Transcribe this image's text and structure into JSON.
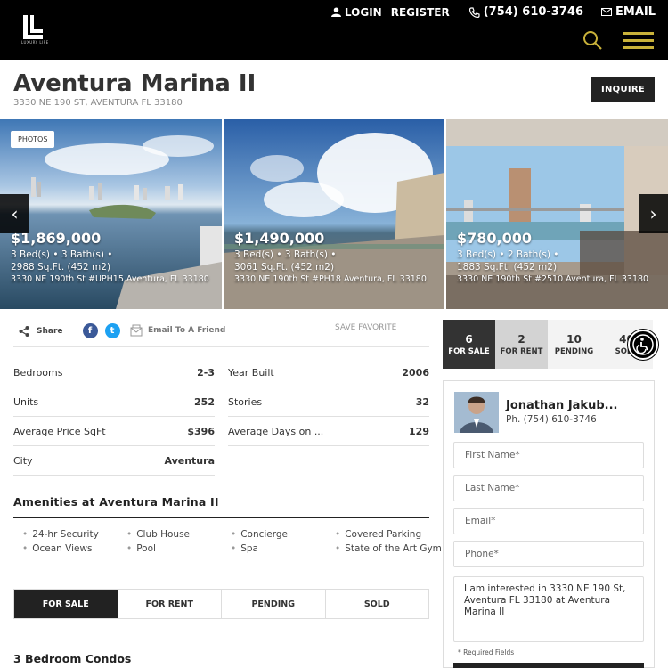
{
  "header": {
    "logo_text": "LUXURY LIFE",
    "login": "LOGIN",
    "register": "REGISTER",
    "phone": "(754) 610-3746",
    "email": "EMAIL"
  },
  "building": {
    "title": "Aventura Marina II",
    "address": "3330 NE 190 ST, AVENTURA FL 33180",
    "inquire": "INQUIRE"
  },
  "carousel": {
    "photos_label": "PHOTOS",
    "listings": [
      {
        "price": "$1,869,000",
        "beds_baths": "3 Bed(s) • 3 Bath(s) •",
        "sqft": "2988 Sq.Ft. (452 m2)",
        "address": "3330 NE 190th St #UPH15 Aventura, FL 33180"
      },
      {
        "price": "$1,490,000",
        "beds_baths": "3 Bed(s) • 3 Bath(s) •",
        "sqft": "3061 Sq.Ft. (452 m2)",
        "address": "3330 NE 190th St #PH18 Aventura, FL 33180"
      },
      {
        "price": "$780,000",
        "beds_baths": "3 Bed(s) • 2 Bath(s) •",
        "sqft": "1883 Sq.Ft. (452 m2)",
        "address": "3330 NE 190th St #2510 Aventura, FL 33180"
      }
    ]
  },
  "share": {
    "share_label": "Share",
    "email_friend": "Email To A Friend",
    "save_favorite": "SAVE FAVORITE"
  },
  "stats": {
    "bedrooms_label": "Bedrooms",
    "bedrooms": "2-3",
    "year_built_label": "Year Built",
    "year_built": "2006",
    "units_label": "Units",
    "units": "252",
    "stories_label": "Stories",
    "stories": "32",
    "avg_price_label": "Average Price SqFt",
    "avg_price": "$396",
    "avg_days_label": "Average Days on ...",
    "avg_days": "129",
    "city_label": "City",
    "city": "Aventura"
  },
  "amenities": {
    "title": "Amenities at Aventura Marina II",
    "items": [
      "24-hr Security",
      "Club House",
      "Concierge",
      "Covered Parking",
      "Ocean Views",
      "Pool",
      "Spa",
      "State of the Art Gym"
    ]
  },
  "tabs": [
    "FOR SALE",
    "FOR RENT",
    "PENDING",
    "SOLD"
  ],
  "section_title": "3 Bedroom Condos",
  "counters": [
    {
      "n": "6",
      "label": "FOR SALE"
    },
    {
      "n": "2",
      "label": "FOR RENT"
    },
    {
      "n": "10",
      "label": "PENDING"
    },
    {
      "n": "40",
      "label": "SOLD"
    }
  ],
  "agent": {
    "name": "Jonathan Jakub...",
    "phone": "Ph. (754) 610-3746",
    "first_name_ph": "First Name*",
    "last_name_ph": "Last Name*",
    "email_ph": "Email*",
    "phone_ph": "Phone*",
    "message": "I am interested in 3330  NE 190 St, Aventura FL 33180 at Aventura Marina II",
    "required": "* Required Fields"
  }
}
